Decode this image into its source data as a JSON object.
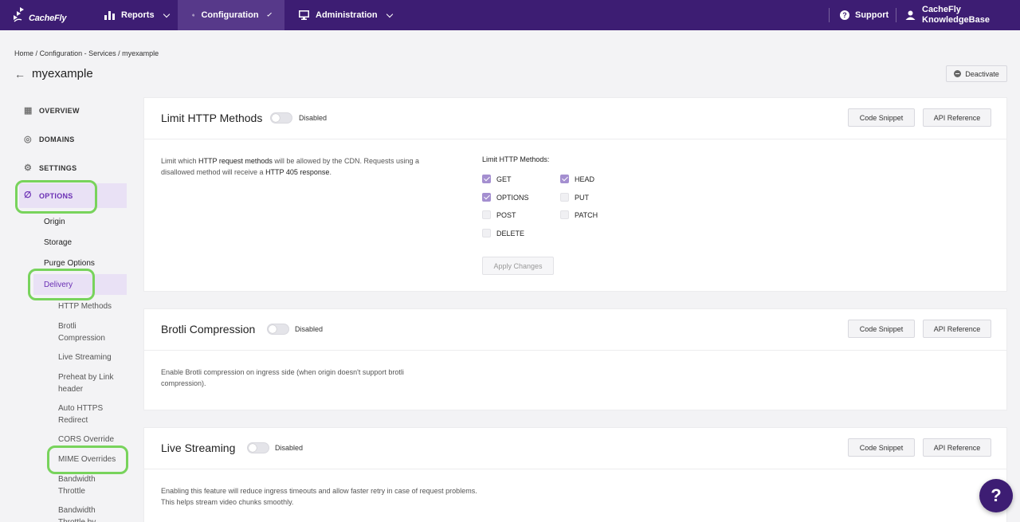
{
  "topnav": {
    "logo_text": "CacheFly",
    "reports": "Reports",
    "configuration": "Configuration",
    "administration": "Administration",
    "support": "Support",
    "kb_line1": "CacheFly",
    "kb_line2": "KnowledgeBase"
  },
  "breadcrumb": {
    "home": "Home",
    "services": "Configuration - Services",
    "current": "myexample",
    "sep": "/"
  },
  "page": {
    "title": "myexample",
    "deactivate": "Deactivate"
  },
  "sidebar": {
    "overview": "OVERVIEW",
    "domains": "DOMAINS",
    "settings": "SETTINGS",
    "options": "OPTIONS",
    "origin": "Origin",
    "storage": "Storage",
    "purge_options": "Purge Options",
    "delivery": "Delivery",
    "http_methods": "HTTP Methods",
    "brotli": "Brotli Compression",
    "live_streaming": "Live Streaming",
    "preheat": "Preheat by Link header",
    "auto_https": "Auto HTTPS Redirect",
    "cors": "CORS Override",
    "mime": "MIME Overrides",
    "bandwidth": "Bandwidth Throttle",
    "bandwidth_by": "Bandwidth Throttle by"
  },
  "cards": {
    "http": {
      "title": "Limit HTTP Methods",
      "status": "Disabled",
      "code_snippet": "Code Snippet",
      "api_reference": "API Reference",
      "desc_1": "Limit which ",
      "desc_b1": "HTTP request methods",
      "desc_2": " will be allowed by the CDN. Requests using a disallowed method will receive a ",
      "desc_b2": "HTTP 405 response",
      "desc_3": ".",
      "methods_title": "Limit HTTP Methods:",
      "methods": {
        "get": "GET",
        "head": "HEAD",
        "options": "OPTIONS",
        "put": "PUT",
        "post": "POST",
        "patch": "PATCH",
        "delete": "DELETE"
      },
      "apply": "Apply Changes"
    },
    "brotli": {
      "title": "Brotli Compression",
      "status": "Disabled",
      "code_snippet": "Code Snippet",
      "api_reference": "API Reference",
      "desc": "Enable Brotli compression on ingress side (when origin doesn't support brotli compression)."
    },
    "live": {
      "title": "Live Streaming",
      "status": "Disabled",
      "code_snippet": "Code Snippet",
      "api_reference": "API Reference",
      "desc": "Enabling this feature will reduce ingress timeouts and allow faster retry in case of request problems. This helps stream video chunks smoothly."
    }
  },
  "help": "?",
  "colors": {
    "nav_bg": "#3d1d73",
    "accent": "#6a2fb4",
    "highlight": "#78d35c"
  }
}
